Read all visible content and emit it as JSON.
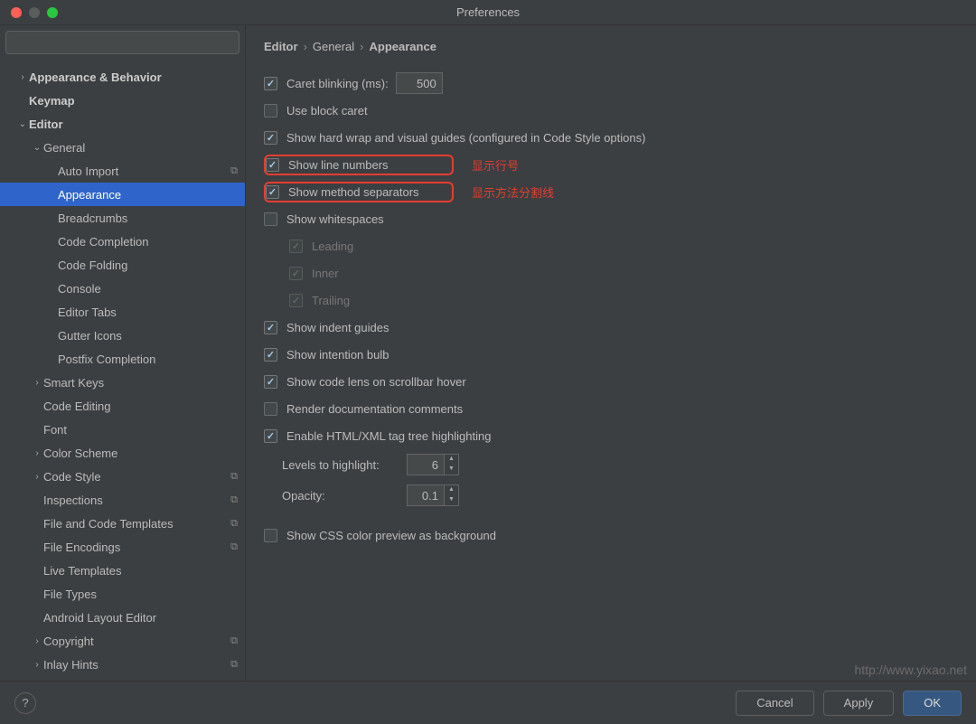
{
  "window": {
    "title": "Preferences"
  },
  "search": {
    "placeholder": ""
  },
  "sidebar": [
    {
      "label": "Appearance & Behavior",
      "depth": 1,
      "arrow": "›",
      "bold": true
    },
    {
      "label": "Keymap",
      "depth": 1,
      "bold": true
    },
    {
      "label": "Editor",
      "depth": 1,
      "arrow": "⌄",
      "bold": true
    },
    {
      "label": "General",
      "depth": 2,
      "arrow": "⌄"
    },
    {
      "label": "Auto Import",
      "depth": 3,
      "copy": true
    },
    {
      "label": "Appearance",
      "depth": 3,
      "selected": true
    },
    {
      "label": "Breadcrumbs",
      "depth": 3
    },
    {
      "label": "Code Completion",
      "depth": 3
    },
    {
      "label": "Code Folding",
      "depth": 3
    },
    {
      "label": "Console",
      "depth": 3
    },
    {
      "label": "Editor Tabs",
      "depth": 3
    },
    {
      "label": "Gutter Icons",
      "depth": 3
    },
    {
      "label": "Postfix Completion",
      "depth": 3
    },
    {
      "label": "Smart Keys",
      "depth": 2,
      "arrow": "›"
    },
    {
      "label": "Code Editing",
      "depth": 2
    },
    {
      "label": "Font",
      "depth": 2
    },
    {
      "label": "Color Scheme",
      "depth": 2,
      "arrow": "›"
    },
    {
      "label": "Code Style",
      "depth": 2,
      "arrow": "›",
      "copy": true
    },
    {
      "label": "Inspections",
      "depth": 2,
      "copy": true
    },
    {
      "label": "File and Code Templates",
      "depth": 2,
      "copy": true
    },
    {
      "label": "File Encodings",
      "depth": 2,
      "copy": true
    },
    {
      "label": "Live Templates",
      "depth": 2
    },
    {
      "label": "File Types",
      "depth": 2
    },
    {
      "label": "Android Layout Editor",
      "depth": 2
    },
    {
      "label": "Copyright",
      "depth": 2,
      "arrow": "›",
      "copy": true
    },
    {
      "label": "Inlay Hints",
      "depth": 2,
      "arrow": "›",
      "copy": true
    }
  ],
  "breadcrumb": [
    "Editor",
    "General",
    "Appearance"
  ],
  "settings": {
    "caret_blinking": {
      "label": "Caret blinking (ms):",
      "checked": true,
      "value": "500"
    },
    "block_caret": {
      "label": "Use block caret",
      "checked": false
    },
    "hard_wrap": {
      "label": "Show hard wrap and visual guides (configured in Code Style options)",
      "checked": true
    },
    "line_numbers": {
      "label": "Show line numbers",
      "checked": true
    },
    "method_sep": {
      "label": "Show method separators",
      "checked": true
    },
    "whitespaces": {
      "label": "Show whitespaces",
      "checked": false
    },
    "leading": {
      "label": "Leading",
      "checked": true
    },
    "inner": {
      "label": "Inner",
      "checked": true
    },
    "trailing": {
      "label": "Trailing",
      "checked": true
    },
    "indent_guides": {
      "label": "Show indent guides",
      "checked": true
    },
    "intention_bulb": {
      "label": "Show intention bulb",
      "checked": true
    },
    "code_lens": {
      "label": "Show code lens on scrollbar hover",
      "checked": true
    },
    "render_doc": {
      "label": "Render documentation comments",
      "checked": false
    },
    "html_highlight": {
      "label": "Enable HTML/XML tag tree highlighting",
      "checked": true
    },
    "levels": {
      "label": "Levels to highlight:",
      "value": "6"
    },
    "opacity": {
      "label": "Opacity:",
      "value": "0.1"
    },
    "css_preview": {
      "label": "Show CSS color preview as background",
      "checked": false
    }
  },
  "annotations": {
    "line_numbers": "显示行号",
    "method_sep": "显示方法分割线"
  },
  "buttons": {
    "cancel": "Cancel",
    "apply": "Apply",
    "ok": "OK"
  },
  "watermark": "http://www.yixao.net"
}
